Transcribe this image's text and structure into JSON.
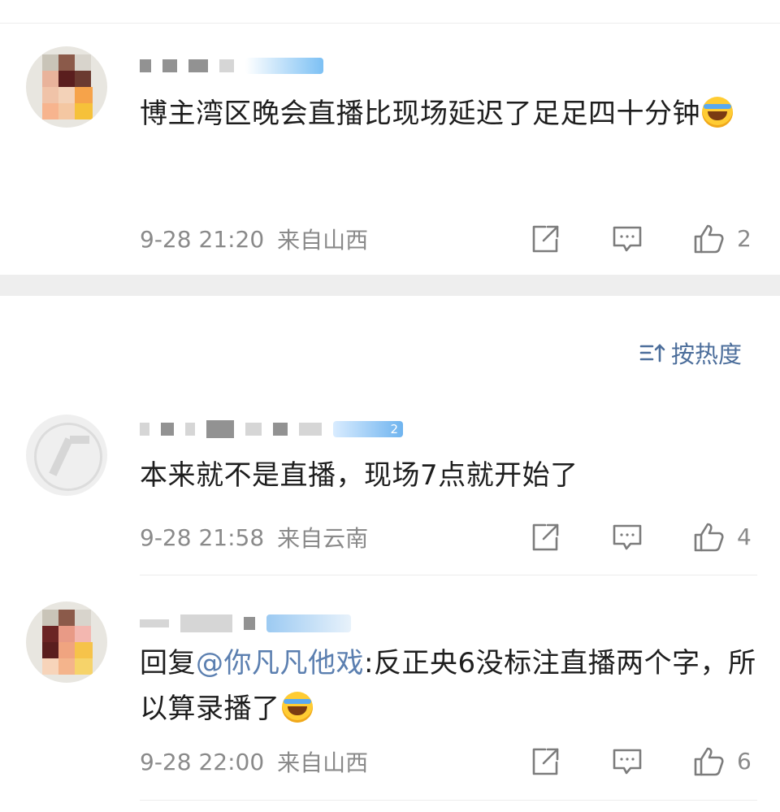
{
  "top_comment": {
    "text": "博主湾区晚会直播比现场延迟了足足四十分钟",
    "time": "9-28 21:20",
    "location": "来自山西",
    "likes": "2"
  },
  "sort": {
    "label": "按热度"
  },
  "comments": [
    {
      "badge": "2",
      "text": "本来就不是直播，现场7点就开始了",
      "time": "9-28 21:58",
      "location": "来自云南",
      "likes": "4"
    },
    {
      "reply_prefix": "回复",
      "reply_name": "@你凡凡他戏",
      "text": ":反正央6没标注直播两个字，所以算录播了",
      "time": "9-28 22:00",
      "location": "来自山西",
      "likes": "6"
    }
  ],
  "icons": {
    "repost": "share-box-icon",
    "comment": "comment-bubble-icon",
    "like": "thumbs-up-icon",
    "sort": "sort-list-icon",
    "emoji": "laugh-cry-emoji-icon"
  },
  "colors": {
    "link": "#5b7fb0",
    "sort": "#4c6e9b",
    "meta": "#8a8a8a",
    "icon": "#7c7c7c"
  }
}
